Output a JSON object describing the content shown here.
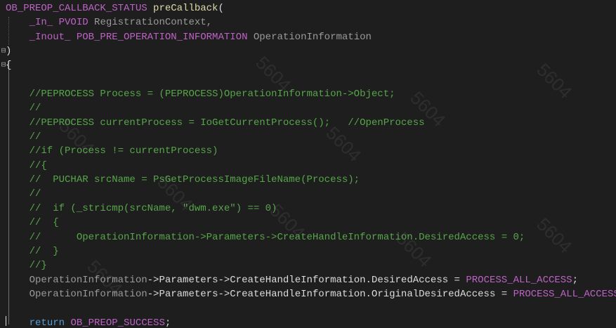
{
  "lines": [
    [
      {
        "t": "OB_PREOP_CALLBACK_STATUS",
        "c": "mac"
      },
      {
        "t": " ",
        "c": ""
      },
      {
        "t": "preCallback",
        "c": "fn"
      },
      {
        "t": "(",
        "c": ""
      }
    ],
    [
      {
        "t": "    ",
        "c": ""
      },
      {
        "t": "_In_",
        "c": "ann"
      },
      {
        "t": " ",
        "c": ""
      },
      {
        "t": "PVOID",
        "c": "mac"
      },
      {
        "t": " RegistrationContext,",
        "c": "prm"
      }
    ],
    [
      {
        "t": "    ",
        "c": ""
      },
      {
        "t": "_Inout_",
        "c": "ann"
      },
      {
        "t": " ",
        "c": ""
      },
      {
        "t": "POB_PRE_OPERATION_INFORMATION",
        "c": "mac"
      },
      {
        "t": " OperationInformation",
        "c": "prm"
      }
    ],
    [
      {
        "t": ")",
        "c": ""
      }
    ],
    [
      {
        "t": "{",
        "c": ""
      }
    ],
    [
      {
        "t": "",
        "c": ""
      }
    ],
    [
      {
        "t": "    //PEPROCESS Process = (PEPROCESS)OperationInformation->Object;",
        "c": "cm"
      }
    ],
    [
      {
        "t": "    //",
        "c": "cm"
      }
    ],
    [
      {
        "t": "    //PEPROCESS currentProcess = IoGetCurrentProcess();   //OpenProcess",
        "c": "cm"
      }
    ],
    [
      {
        "t": "    //",
        "c": "cm"
      }
    ],
    [
      {
        "t": "    //if (Process != currentProcess)",
        "c": "cm"
      }
    ],
    [
      {
        "t": "    //{",
        "c": "cm"
      }
    ],
    [
      {
        "t": "    //  PUCHAR srcName = PsGetProcessImageFileName(Process);",
        "c": "cm"
      }
    ],
    [
      {
        "t": "    //",
        "c": "cm"
      }
    ],
    [
      {
        "t": "    //  if (_stricmp(srcName, \"dwm.exe\") == 0)",
        "c": "cm"
      }
    ],
    [
      {
        "t": "    //  {",
        "c": "cm"
      }
    ],
    [
      {
        "t": "    //      OperationInformation->Parameters->CreateHandleInformation.DesiredAccess = 0;",
        "c": "cm"
      }
    ],
    [
      {
        "t": "    //  }",
        "c": "cm"
      }
    ],
    [
      {
        "t": "    //}",
        "c": "cm"
      }
    ],
    [
      {
        "t": "    OperationInformation",
        "c": "prm"
      },
      {
        "t": "->",
        "c": ""
      },
      {
        "t": "Parameters",
        "c": ""
      },
      {
        "t": "->",
        "c": ""
      },
      {
        "t": "CreateHandleInformation",
        "c": ""
      },
      {
        "t": ".",
        "c": ""
      },
      {
        "t": "DesiredAccess",
        "c": ""
      },
      {
        "t": " = ",
        "c": ""
      },
      {
        "t": "PROCESS_ALL_ACCESS",
        "c": "mac"
      },
      {
        "t": ";",
        "c": ""
      }
    ],
    [
      {
        "t": "    OperationInformation",
        "c": "prm"
      },
      {
        "t": "->",
        "c": ""
      },
      {
        "t": "Parameters",
        "c": ""
      },
      {
        "t": "->",
        "c": ""
      },
      {
        "t": "CreateHandleInformation",
        "c": ""
      },
      {
        "t": ".",
        "c": ""
      },
      {
        "t": "OriginalDesiredAccess",
        "c": ""
      },
      {
        "t": " = ",
        "c": ""
      },
      {
        "t": "PROCESS_ALL_ACCESS",
        "c": "mac"
      },
      {
        "t": ";",
        "c": ""
      }
    ],
    [
      {
        "t": "",
        "c": ""
      }
    ],
    [
      {
        "t": "    ",
        "c": ""
      },
      {
        "t": "return",
        "c": "kw"
      },
      {
        "t": " ",
        "c": ""
      },
      {
        "t": "OB_PREOP_SUCCESS",
        "c": "mac"
      },
      {
        "t": ";",
        "c": ""
      }
    ]
  ],
  "fold_icons": [
    {
      "line": 3,
      "symbol": "⊟"
    },
    {
      "line": 4,
      "symbol": "⊟"
    }
  ],
  "watermark": "5604"
}
